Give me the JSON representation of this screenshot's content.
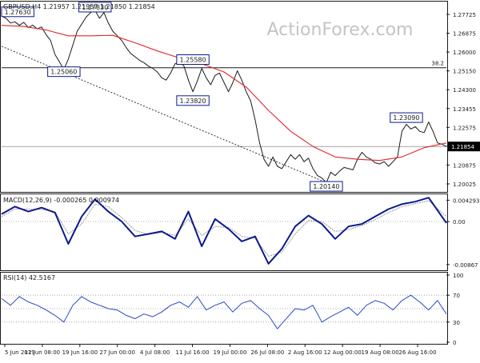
{
  "watermark": "ActionForex.com",
  "colors": {
    "price": "#1a1a1a",
    "ma": "#e0262b",
    "macd": "#0d1a8c",
    "signal": "#9a9a9a",
    "rsi": "#2b49c8",
    "box_border": "#0d1a8c",
    "grid": "#1a1a1a"
  },
  "chart_data": [
    {
      "type": "line",
      "panel": "price",
      "title": "GBPUSD,H4  1.21957 1.21957 1.21850 1.21854",
      "current_price_label": "1.21854",
      "y_ticks": [
        "1.27725",
        "1.26875",
        "1.26000",
        "1.25150",
        "1.24300",
        "1.23455",
        "1.22575",
        "1.21725",
        "1.20875",
        "1.20025"
      ],
      "ylim": [
        1.1997,
        1.28
      ],
      "x_ticks": [
        "5 Jun 2019",
        "12 Jun 08:00",
        "19 Jun 16:00",
        "27 Jun 00:00",
        "4 Jul 08:00",
        "11 Jul 16:00",
        "19 Jul 00:00",
        "26 Jul 08:00",
        "2 Aug 16:00",
        "12 Aug 00:00",
        "19 Aug 08:00",
        "26 Aug 16:00"
      ],
      "xlim": [
        0,
        100
      ],
      "fib_label": "38.2",
      "fib_level": 1.2523,
      "price_level_line": 1.2185,
      "trendline": {
        "x1": 0,
        "y1": 1.2615,
        "x2": 75,
        "y2": 1.2014
      },
      "annotations": [
        {
          "text": "1.27630",
          "x": 1,
          "y": 1.2763
        },
        {
          "text": "1.27830",
          "x": 21,
          "y": 1.2783
        },
        {
          "text": "1.25060",
          "x": 14,
          "y": 1.2506
        },
        {
          "text": "1.25580",
          "x": 43,
          "y": 1.2558
        },
        {
          "text": "1.23820",
          "x": 43,
          "y": 1.2382
        },
        {
          "text": "1.20140",
          "x": 73,
          "y": 1.2014
        },
        {
          "text": "1.23090",
          "x": 91,
          "y": 1.2309
        }
      ],
      "series": [
        {
          "x": [
            0,
            1,
            2,
            3,
            4,
            5,
            6,
            7,
            8,
            9,
            10,
            11,
            12,
            13,
            14,
            15,
            16,
            17,
            18,
            19,
            20,
            21,
            22,
            23,
            24,
            25,
            26,
            27,
            28,
            29,
            30,
            31,
            32,
            33,
            34,
            35,
            36,
            37,
            38,
            39,
            40,
            41,
            42,
            43,
            44,
            45,
            46,
            47,
            48,
            49,
            50,
            51,
            52,
            53,
            54,
            55,
            56,
            57,
            58,
            59,
            60,
            61,
            62,
            63,
            64,
            65,
            66,
            67,
            68,
            69,
            70,
            71,
            72,
            73,
            74,
            75,
            76,
            77,
            78,
            79,
            80,
            81,
            82,
            83,
            84,
            85,
            86,
            87,
            88,
            89,
            90,
            91,
            92,
            93,
            94,
            95,
            96,
            97,
            98,
            99,
            100
          ],
          "values": [
            1.2745,
            1.2735,
            1.2715,
            1.272,
            1.2705,
            1.2718,
            1.2695,
            1.2706,
            1.269,
            1.2698,
            1.2665,
            1.264,
            1.258,
            1.2548,
            1.2515,
            1.256,
            1.262,
            1.268,
            1.271,
            1.274,
            1.276,
            1.277,
            1.2735,
            1.276,
            1.2715,
            1.268,
            1.266,
            1.264,
            1.261,
            1.2585,
            1.257,
            1.2555,
            1.2545,
            1.253,
            1.252,
            1.2505,
            1.248,
            1.247,
            1.25,
            1.254,
            1.255,
            1.253,
            1.247,
            1.242,
            1.2465,
            1.252,
            1.248,
            1.245,
            1.249,
            1.25,
            1.246,
            1.242,
            1.246,
            1.251,
            1.247,
            1.242,
            1.238,
            1.23,
            1.22,
            1.213,
            1.21,
            1.214,
            1.21,
            1.209,
            1.212,
            1.215,
            1.213,
            1.215,
            1.212,
            1.2135,
            1.209,
            1.206,
            1.205,
            1.203,
            1.2075,
            1.206,
            1.208,
            1.2095,
            1.209,
            1.2085,
            1.213,
            1.216,
            1.214,
            1.213,
            1.2115,
            1.211,
            1.212,
            1.21,
            1.212,
            1.214,
            1.225,
            1.228,
            1.226,
            1.227,
            1.225,
            1.2245,
            1.229,
            1.225,
            1.22,
            1.2195,
            1.2185
          ]
        },
        {
          "name": "MA",
          "x": [
            0,
            5,
            10,
            15,
            20,
            25,
            30,
            35,
            40,
            45,
            50,
            55,
            60,
            65,
            70,
            75,
            80,
            85,
            90,
            95,
            100
          ],
          "values": [
            1.2705,
            1.27,
            1.2685,
            1.266,
            1.266,
            1.2662,
            1.263,
            1.2595,
            1.2565,
            1.254,
            1.2505,
            1.244,
            1.234,
            1.225,
            1.2185,
            1.214,
            1.213,
            1.2125,
            1.214,
            1.218,
            1.22
          ]
        }
      ]
    },
    {
      "type": "line",
      "panel": "macd",
      "title": "MACD(12,26,9) -0.000265 0.000974",
      "y_ticks": [
        "0.004293",
        "0.00",
        "-0.00867"
      ],
      "ylim": [
        -0.0095,
        0.005
      ],
      "xlim": [
        0,
        100
      ],
      "series": [
        {
          "x": [
            0,
            3,
            6,
            9,
            12,
            15,
            18,
            21,
            24,
            27,
            30,
            33,
            36,
            39,
            42,
            45,
            48,
            51,
            54,
            57,
            60,
            63,
            66,
            69,
            72,
            75,
            78,
            81,
            84,
            87,
            90,
            93,
            96,
            100
          ],
          "values": [
            0.0015,
            0.003,
            0.002,
            0.0028,
            0.0018,
            -0.0045,
            0.001,
            0.0045,
            0.002,
            0.0,
            -0.003,
            -0.0025,
            -0.002,
            -0.0035,
            0.002,
            -0.005,
            0.0005,
            -0.0015,
            -0.004,
            -0.003,
            -0.0085,
            -0.0055,
            -0.001,
            0.0012,
            -0.0005,
            -0.0035,
            -0.001,
            -0.0005,
            0.001,
            0.0025,
            0.0035,
            0.004,
            0.0048,
            -0.0003
          ]
        },
        {
          "x": [
            0,
            3,
            6,
            9,
            12,
            15,
            18,
            21,
            24,
            27,
            30,
            33,
            36,
            39,
            42,
            45,
            48,
            51,
            54,
            57,
            60,
            63,
            66,
            69,
            72,
            75,
            78,
            81,
            84,
            87,
            90,
            93,
            96,
            100
          ],
          "values": [
            0.001,
            0.0025,
            0.0025,
            0.0024,
            0.002,
            -0.0025,
            -0.0005,
            0.0035,
            0.003,
            0.0008,
            -0.0018,
            -0.0026,
            -0.0022,
            -0.0028,
            0.0005,
            -0.0028,
            -0.001,
            -0.0012,
            -0.003,
            -0.0034,
            -0.007,
            -0.0062,
            -0.0025,
            0.0002,
            0.0,
            -0.002,
            -0.0016,
            -0.0008,
            0.0004,
            0.0018,
            0.003,
            0.0036,
            0.0042,
            0.001
          ]
        }
      ]
    },
    {
      "type": "line",
      "panel": "rsi",
      "title": "RSI(14) 42.5167",
      "y_ticks": [
        "100",
        "70",
        "30",
        "0"
      ],
      "ylim": [
        0,
        100
      ],
      "guide_levels": [
        70,
        50,
        30
      ],
      "xlim": [
        0,
        100
      ],
      "series": [
        {
          "x": [
            0,
            2,
            4,
            6,
            8,
            10,
            12,
            14,
            16,
            18,
            20,
            22,
            24,
            26,
            28,
            30,
            32,
            34,
            36,
            38,
            40,
            42,
            44,
            46,
            48,
            50,
            52,
            54,
            56,
            58,
            60,
            62,
            64,
            66,
            68,
            70,
            72,
            74,
            76,
            78,
            80,
            82,
            84,
            86,
            88,
            90,
            92,
            94,
            96,
            98,
            100
          ],
          "values": [
            65,
            55,
            68,
            60,
            55,
            48,
            40,
            30,
            55,
            68,
            60,
            55,
            50,
            48,
            40,
            35,
            42,
            38,
            45,
            55,
            60,
            52,
            68,
            48,
            55,
            60,
            45,
            58,
            62,
            50,
            40,
            20,
            35,
            50,
            48,
            55,
            30,
            38,
            45,
            52,
            40,
            55,
            62,
            58,
            48,
            62,
            70,
            60,
            48,
            62,
            42
          ]
        }
      ]
    }
  ]
}
